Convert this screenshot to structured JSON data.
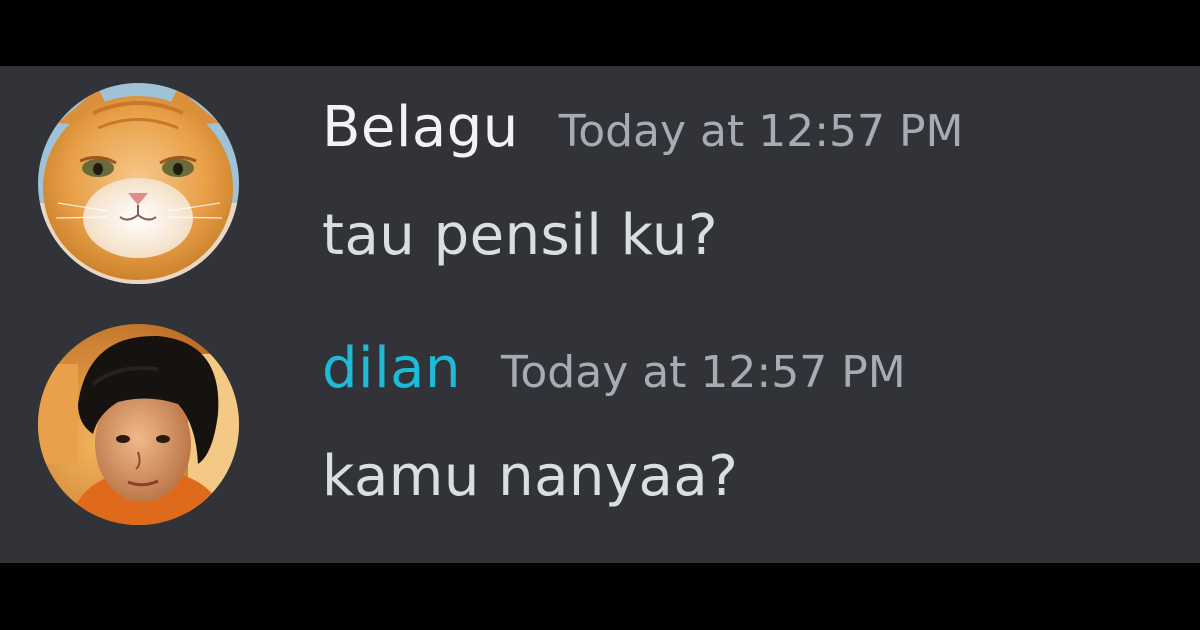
{
  "messages": [
    {
      "username": "Belagu",
      "username_color": "#f2f3f5",
      "timestamp": "Today at 12:57 PM",
      "text": "tau pensil ku?",
      "avatar": "orange-cat-avatar"
    },
    {
      "username": "dilan",
      "username_color": "#1ebbd7",
      "timestamp": "Today at 12:57 PM",
      "text": "kamu nanyaa?",
      "avatar": "person-photo-avatar"
    }
  ],
  "colors": {
    "panel_background": "#313338",
    "frame_background": "#000000",
    "timestamp": "#a8abb2",
    "message_text": "#dbdee1"
  }
}
